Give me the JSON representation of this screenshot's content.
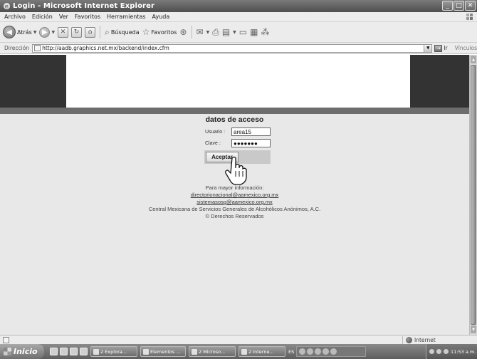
{
  "window": {
    "title": "Login - Microsoft Internet Explorer",
    "controls": [
      "minimize",
      "maximize",
      "close"
    ]
  },
  "menu": [
    "Archivo",
    "Edición",
    "Ver",
    "Favoritos",
    "Herramientas",
    "Ayuda"
  ],
  "toolbar": {
    "back_label": "Atrás",
    "search_label": "Búsqueda",
    "favorites_label": "Favoritos"
  },
  "address": {
    "label": "Dirección",
    "url": "http://aadb.graphics.net.mx/backend/index.cfm",
    "go_label": "Ir",
    "links_label": "Vínculos"
  },
  "login": {
    "title": "datos de acceso",
    "user_label": "Usuario :",
    "user_value": "area15",
    "pass_label": "Clave :",
    "pass_value": "●●●●●●●",
    "submit_label": "Aceptar"
  },
  "info": {
    "line1": "Para mayor información:",
    "email1": "directorionacional@aamexico.org.mx",
    "email2": "sistemasosg@aamexico.org.mx",
    "org": "Central Mexicana de Servicios Generales de Alcohólicos Anónimos, A.C.",
    "rights": "© Derechos Reservados"
  },
  "status": {
    "zone": "Internet"
  },
  "taskbar": {
    "start_label": "Inicio",
    "tasks": [
      "2 Explora...",
      "Elementos ...",
      "2 Microso...",
      "2 Interne..."
    ],
    "lang": "ES",
    "clock": "11:53 a.m."
  },
  "colors": {
    "header_dark": "#333333",
    "content_bg": "#e8e8e8",
    "strip": "#6d6d6d"
  }
}
